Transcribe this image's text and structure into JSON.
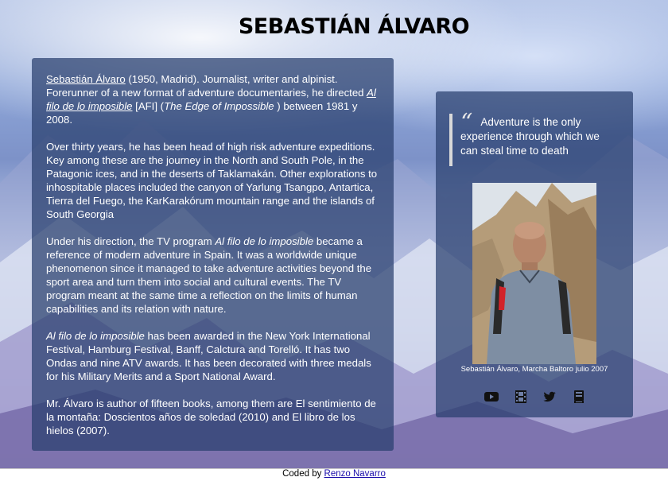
{
  "header": {
    "title": "SEBASTIÁN ÁLVARO"
  },
  "bio": {
    "p1": {
      "name_link": "Sebastián Álvaro",
      "text_a": " (1950, Madrid). Journalist, writer and alpinist. Forerunner of a new format of adventure documentaries, he directed ",
      "show_link": "Al filo de lo imposible",
      "text_b": " [AFI] (",
      "show_english": "The Edge of Impossible",
      "text_c": " ) between 1981 y 2008."
    },
    "p2": "Over thirty years, he has been head of high risk adventure expeditions. Key among these are the journey in the North and South Pole, in the Patagonic ices, and in the deserts of Taklamakán. Other explorations to inhospitable places included the canyon of Yarlung Tsangpo, Antartica, Tierra del Fuego, the KarKarakórum mountain range and the islands of South Georgia",
    "p3": {
      "text_a": "Under his direction, the TV program ",
      "show": "Al filo de lo imposible",
      "text_b": " became a reference of modern adventure in Spain. It was a worldwide unique phenomenon since it managed to take adventure activities beyond the sport area and turn them into social and cultural events. The TV program meant at the same time a reflection on the limits of human capabilities and its relation with nature."
    },
    "p4": {
      "show": "Al filo de lo imposible",
      "text": " has been awarded in the New York International Festival, Hamburg Festival, Banff, Calctura and Torelló. It has two Ondas and nine ATV awards. It has been decorated with three medals for his Military Merits and a Sport National Award."
    },
    "p5": "Mr. Álvaro is author of fifteen books, among them are El sentimiento de la montaña: Doscientos años de soledad (2010) and El libro de los hielos (2007)."
  },
  "side": {
    "quote": "Adventure is the only experience through which we can steal time to death",
    "caption": "Sebastián Álvaro, Marcha Baltoro julio 2007",
    "social": [
      "youtube-icon",
      "film-icon",
      "twitter-icon",
      "book-icon"
    ]
  },
  "footer": {
    "prefix": "Coded by",
    "author": "Renzo Navarro"
  }
}
